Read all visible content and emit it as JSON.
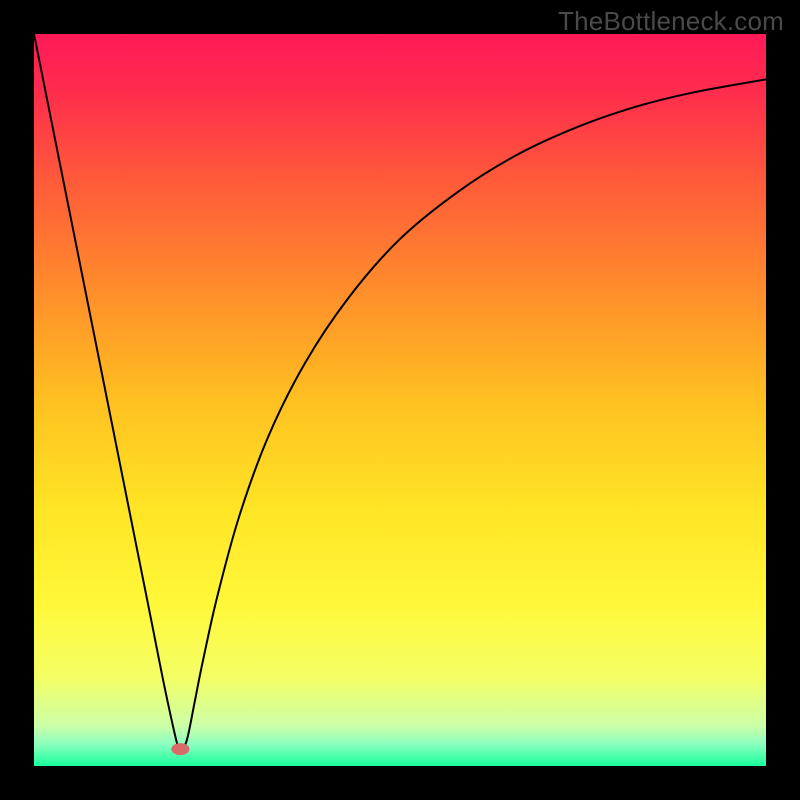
{
  "watermark": "TheBottleneck.com",
  "chart_data": {
    "type": "line",
    "title": "",
    "xlabel": "",
    "ylabel": "",
    "xlim": [
      0,
      100
    ],
    "ylim": [
      0,
      100
    ],
    "background_gradient": {
      "stops": [
        {
          "offset": 0.0,
          "color": "#ff1957"
        },
        {
          "offset": 0.08,
          "color": "#ff2d4d"
        },
        {
          "offset": 0.2,
          "color": "#ff5a3a"
        },
        {
          "offset": 0.35,
          "color": "#ff8d2b"
        },
        {
          "offset": 0.5,
          "color": "#ffc021"
        },
        {
          "offset": 0.65,
          "color": "#ffe525"
        },
        {
          "offset": 0.78,
          "color": "#fff83a"
        },
        {
          "offset": 0.88,
          "color": "#f4ff66"
        },
        {
          "offset": 0.945,
          "color": "#ccffa8"
        },
        {
          "offset": 0.97,
          "color": "#8cffc0"
        },
        {
          "offset": 1.0,
          "color": "#18ff9b"
        }
      ]
    },
    "series": [
      {
        "name": "bottleneck-curve",
        "color": "#000000",
        "x": [
          0,
          2,
          4,
          6,
          8,
          10,
          12,
          14,
          16,
          18,
          19.7,
          20.3,
          21,
          22,
          23,
          25,
          28,
          32,
          37,
          43,
          50,
          58,
          66,
          74,
          82,
          90,
          100
        ],
        "y": [
          100,
          90,
          80,
          70,
          60,
          50,
          40,
          30,
          20,
          10,
          2.5,
          2.2,
          4,
          9,
          14,
          23,
          34,
          45,
          55,
          64,
          72,
          78.5,
          83.5,
          87.2,
          90.0,
          92.0,
          93.8
        ]
      }
    ],
    "marker": {
      "name": "optimal-point",
      "x": 20,
      "y": 2.3,
      "color": "#d86a6a",
      "rx": 9,
      "ry": 6
    }
  }
}
